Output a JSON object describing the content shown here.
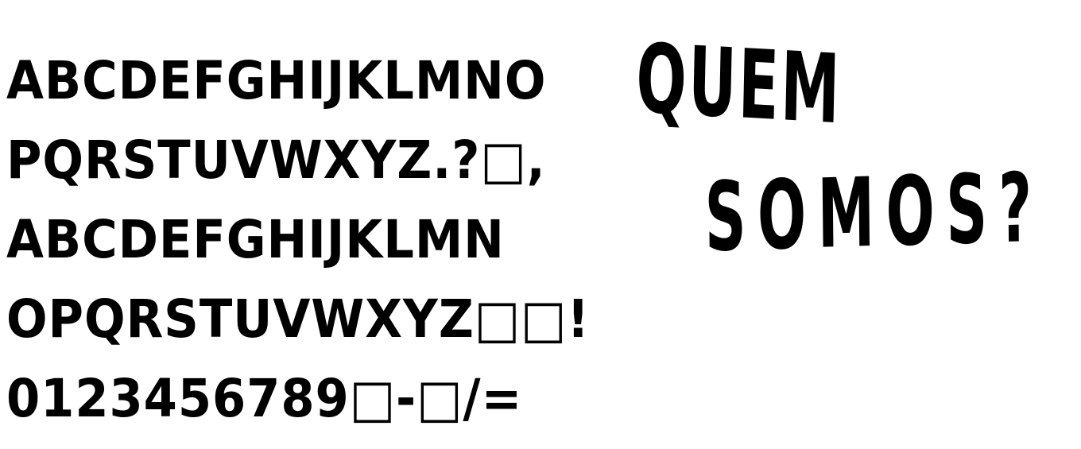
{
  "specimen": {
    "lines": [
      "ABCDEFGHIJKLMNO",
      "PQRSTUVWXYZ.?□,",
      "ABCDEFGHIJKLMN",
      "OPQRSTUVWXYZ□□!",
      "0123456789□-□/="
    ]
  },
  "heading": {
    "line1": "QUEM",
    "line2": "SOMOS?"
  }
}
